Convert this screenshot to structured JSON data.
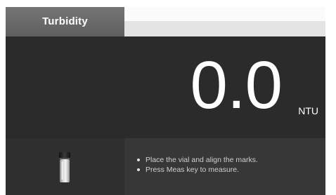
{
  "header": {
    "tab_label": "Turbidity"
  },
  "reading": {
    "value": "0.0",
    "unit": "NTU"
  },
  "instructions": [
    "Place the vial and align the marks.",
    "Press Meas key to measure."
  ],
  "icons": {
    "vial": "vial-icon"
  },
  "colors": {
    "tab_background": "#6a6a6a",
    "reading_background": "#2b2b2b",
    "instruction_background": "#373737",
    "text_primary": "#ffffff",
    "text_secondary": "#cfcfcf"
  }
}
